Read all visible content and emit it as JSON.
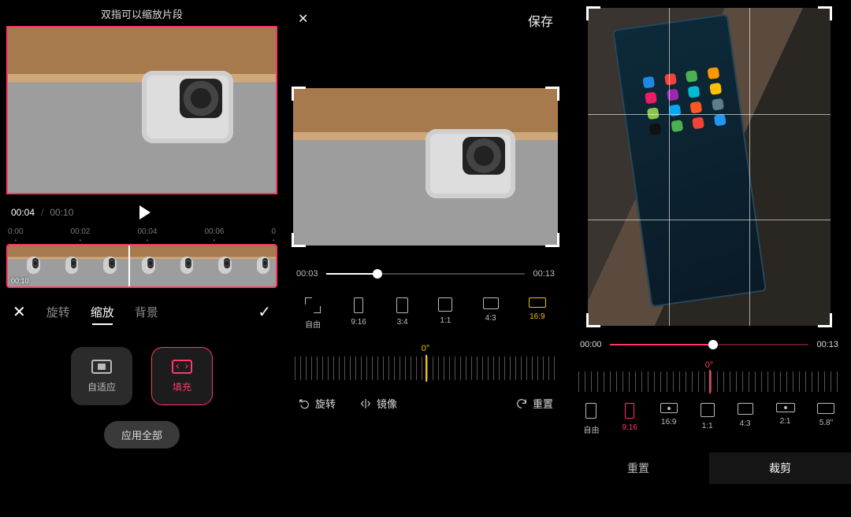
{
  "panel1": {
    "hint": "双指可以缩放片段",
    "current_time": "00:04",
    "total_time": "00:10",
    "ruler": [
      "0:00",
      "00:02",
      "00:04",
      "00:06",
      "0"
    ],
    "clip_duration": "00:10",
    "tabs": {
      "rotate": "旋转",
      "zoom": "缩放",
      "background": "背景"
    },
    "modes": {
      "fit": "自适应",
      "fill": "填充"
    },
    "apply_all": "应用全部"
  },
  "panel2": {
    "close": "✕",
    "save": "保存",
    "start": "00:03",
    "end": "00:13",
    "progress_pct": 26,
    "ratios": {
      "free": "自由",
      "r916": "9:16",
      "r34": "3:4",
      "r11": "1:1",
      "r43": "4:3",
      "r169": "16:9"
    },
    "angle": "0°",
    "rotate": "旋转",
    "mirror": "镜像",
    "reset": "重置"
  },
  "panel3": {
    "start": "00:00",
    "end": "00:13",
    "progress_pct": 52,
    "angle": "0°",
    "ratios": {
      "free": "自由",
      "r916": "9:16",
      "r169": "16:9",
      "r11": "1:1",
      "r43": "4:3",
      "r21": "2:1",
      "r58": "5.8\""
    },
    "reset": "重置",
    "crop": "裁剪"
  }
}
